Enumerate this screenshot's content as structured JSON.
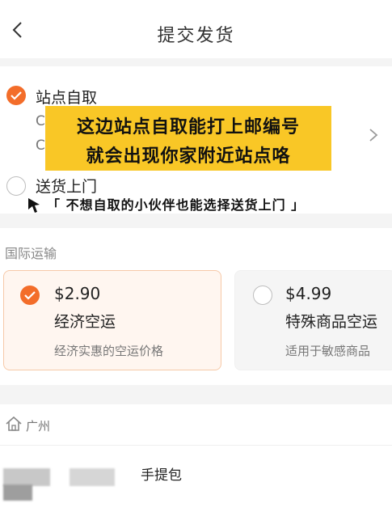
{
  "header": {
    "title": "提交发货"
  },
  "delivery": {
    "pickup_label": "站点自取",
    "partial_line_1": "C",
    "partial_line_2": "C",
    "home_label": "送货上门"
  },
  "overlay": {
    "banner_line_1": "这边站点自取能打上邮编号",
    "banner_line_2": "就会出现你家附近站点咯",
    "annotation": "「 不想自取的小伙伴也能选择送货上门 」"
  },
  "international": {
    "section_title": "国际运输",
    "options": [
      {
        "price": "$2.90",
        "name": "经济空运",
        "desc": "经济实惠的空运价格",
        "selected": true
      },
      {
        "price": "$4.99",
        "name": "特殊商品空运",
        "desc": "适用于敏感商品",
        "selected": false
      }
    ]
  },
  "warehouse": {
    "city": "广州"
  },
  "product": {
    "name": "手提包"
  },
  "colors": {
    "accent": "#f36d2a",
    "banner": "#f9c726"
  },
  "icons": [
    "back-arrow-icon",
    "check-icon",
    "chevron-right-icon",
    "cursor-arrow-icon",
    "home-icon"
  ]
}
